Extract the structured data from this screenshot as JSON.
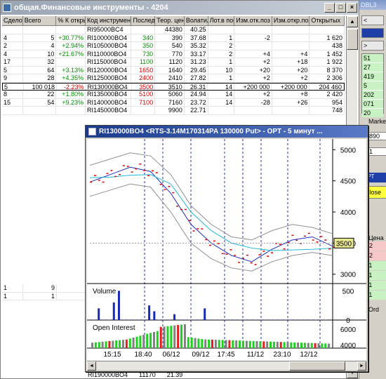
{
  "main_window": {
    "title": "общая.Финансовые инструменты - 4204",
    "columns": [
      "Сделок",
      "Всего",
      "% К открыт",
      "Код инструмента",
      "Послед",
      "Теор. цена",
      "Волатил",
      "Лот.в пок",
      "Изм.отк.поз",
      "Изм.откр.поз",
      "Открытых"
    ],
    "rows": [
      {
        "deals": "",
        "total": "",
        "pct": "",
        "code": "RI95000BC4",
        "last": "",
        "theor": "44380",
        "vol": "40.25",
        "lot": "",
        "chg1": "",
        "chg2": "",
        "open": ""
      },
      {
        "deals": "4",
        "total": "5",
        "pct": "+30.77%",
        "code": "RI100000BO4",
        "last": "340",
        "theor": "390",
        "vol": "37.68",
        "lot": "1",
        "chg1": "-2",
        "chg2": "",
        "open": "1 620"
      },
      {
        "deals": "2",
        "total": "4",
        "pct": "+2.94%",
        "code": "RI105000BO4",
        "last": "350",
        "theor": "540",
        "vol": "35.32",
        "lot": "2",
        "chg1": "",
        "chg2": "",
        "open": "438"
      },
      {
        "deals": "4",
        "total": "10",
        "pct": "+21.67%",
        "code": "RI110000BO4",
        "last": "730",
        "theor": "770",
        "vol": "33.17",
        "lot": "2",
        "chg1": "+4",
        "chg2": "+4",
        "open": "1 452"
      },
      {
        "deals": "17",
        "total": "32",
        "pct": "",
        "code": "RI115000BO4",
        "last": "1100",
        "theor": "1120",
        "vol": "31.23",
        "lot": "1",
        "chg1": "+2",
        "chg2": "+18",
        "open": "1 922"
      },
      {
        "deals": "5",
        "total": "64",
        "pct": "+3.13%",
        "code": "RI120000BO4",
        "last": "1650",
        "theor": "1640",
        "vol": "29.45",
        "lot": "10",
        "chg1": "+20",
        "chg2": "+20",
        "open": "8 370"
      },
      {
        "deals": "9",
        "total": "28",
        "pct": "+4.35%",
        "code": "RI125000BO4",
        "last": "2400",
        "theor": "2410",
        "vol": "27.82",
        "lot": "1",
        "chg1": "+2",
        "chg2": "+2",
        "open": "2 306"
      },
      {
        "deals": "5",
        "total": "100 018",
        "pct": "-2.23%",
        "code": "RI130000BO4",
        "last": "3500",
        "theor": "3510",
        "vol": "26.31",
        "lot": "14",
        "chg1": "+200 000",
        "chg2": "+200 000",
        "open": "204 460"
      },
      {
        "deals": "8",
        "total": "22",
        "pct": "+1.80%",
        "code": "RI135000BO4",
        "last": "5100",
        "theor": "5060",
        "vol": "24.94",
        "lot": "14",
        "chg1": "+2",
        "chg2": "+8",
        "open": "2 420"
      },
      {
        "deals": "15",
        "total": "54",
        "pct": "+9.23%",
        "code": "RI140000BO4",
        "last": "7100",
        "theor": "7160",
        "vol": "23.72",
        "lot": "14",
        "chg1": "-28",
        "chg2": "+26",
        "open": "954"
      },
      {
        "deals": "",
        "total": "",
        "pct": "",
        "code": "RI145000BO4",
        "last": "",
        "theor": "9900",
        "vol": "22.71",
        "lot": "",
        "chg1": "",
        "chg2": "",
        "open": "748"
      }
    ],
    "lower_rows": [
      {
        "deals": "1",
        "total": "9"
      },
      {
        "deals": "1",
        "total": "1"
      }
    ],
    "bottom_partial": {
      "code": "RI190000BO4",
      "theor": "11170",
      "vol": "21.39"
    }
  },
  "chart_window": {
    "title": "RI130000BO4  <RTS-3.14M170314PA 130000 Put> - OPT - 5 минут ...",
    "price_label": "3500",
    "volume_label": "Volume",
    "oi_label": "Open Interest",
    "time_labels": [
      "15:15",
      "18:40",
      "06/12",
      "09/12",
      "17:45",
      "11/12",
      "23:10",
      "12/12"
    ]
  },
  "chart_data": [
    {
      "type": "line",
      "title": "RI130000BO4",
      "y_ticks": [
        3000,
        3500,
        4000,
        4500,
        5000
      ],
      "ylim": [
        2850,
        5150
      ],
      "x": [
        "15:15",
        "18:40",
        "06/12",
        "09/12",
        "17:45",
        "11/12",
        "23:10",
        "12/12"
      ],
      "series": [
        {
          "values": [
            4480,
            4600,
            4720,
            4650,
            4300,
            3800,
            3500,
            3300,
            3200,
            3400,
            3550,
            3600,
            3450
          ]
        },
        {
          "values": [
            4550,
            4560,
            4590,
            4600,
            4450,
            4000,
            3700,
            3500,
            3420,
            3380,
            3390,
            3400,
            3420
          ]
        },
        {
          "values": [
            4750,
            4850,
            4950,
            4900,
            4600,
            4100,
            3800,
            3600,
            3550,
            3700,
            3800,
            3750,
            3650
          ]
        },
        {
          "values": [
            4250,
            4350,
            4450,
            4400,
            4000,
            3500,
            3250,
            3100,
            3050,
            3200,
            3300,
            3350,
            3300
          ]
        }
      ]
    },
    {
      "type": "bar",
      "title": "Volume",
      "y_ticks": [
        0,
        500
      ],
      "ylim": [
        0,
        600
      ],
      "values": [
        5,
        200,
        5,
        5,
        300,
        500,
        5,
        5,
        5,
        5,
        5,
        250,
        150,
        5,
        5,
        5,
        100,
        5,
        5,
        5,
        5,
        5,
        200,
        5,
        5,
        5,
        5,
        5,
        5,
        5,
        5,
        5,
        5,
        5,
        5,
        5,
        5,
        5,
        5,
        5,
        5,
        5,
        5,
        5,
        5,
        5,
        5
      ]
    },
    {
      "type": "bar",
      "title": "Open Interest",
      "y_ticks": [
        4000,
        6000
      ],
      "ylim": [
        3600,
        7000
      ]
    }
  ],
  "bg_window": {
    "title": "DBL3",
    "tabs": [
      "<",
      ">"
    ],
    "green_items": [
      "51",
      "27",
      "419",
      "5",
      "202",
      "071",
      "20"
    ],
    "close_label": "Close",
    "market_label": "Marke",
    "value_890": "890",
    "stack_items": [
      "12",
      "12",
      "11",
      "11",
      "11",
      "11"
    ],
    "dnd_label": "OPT",
    "cena_label": "Цена",
    "orders_label": "Ord"
  }
}
